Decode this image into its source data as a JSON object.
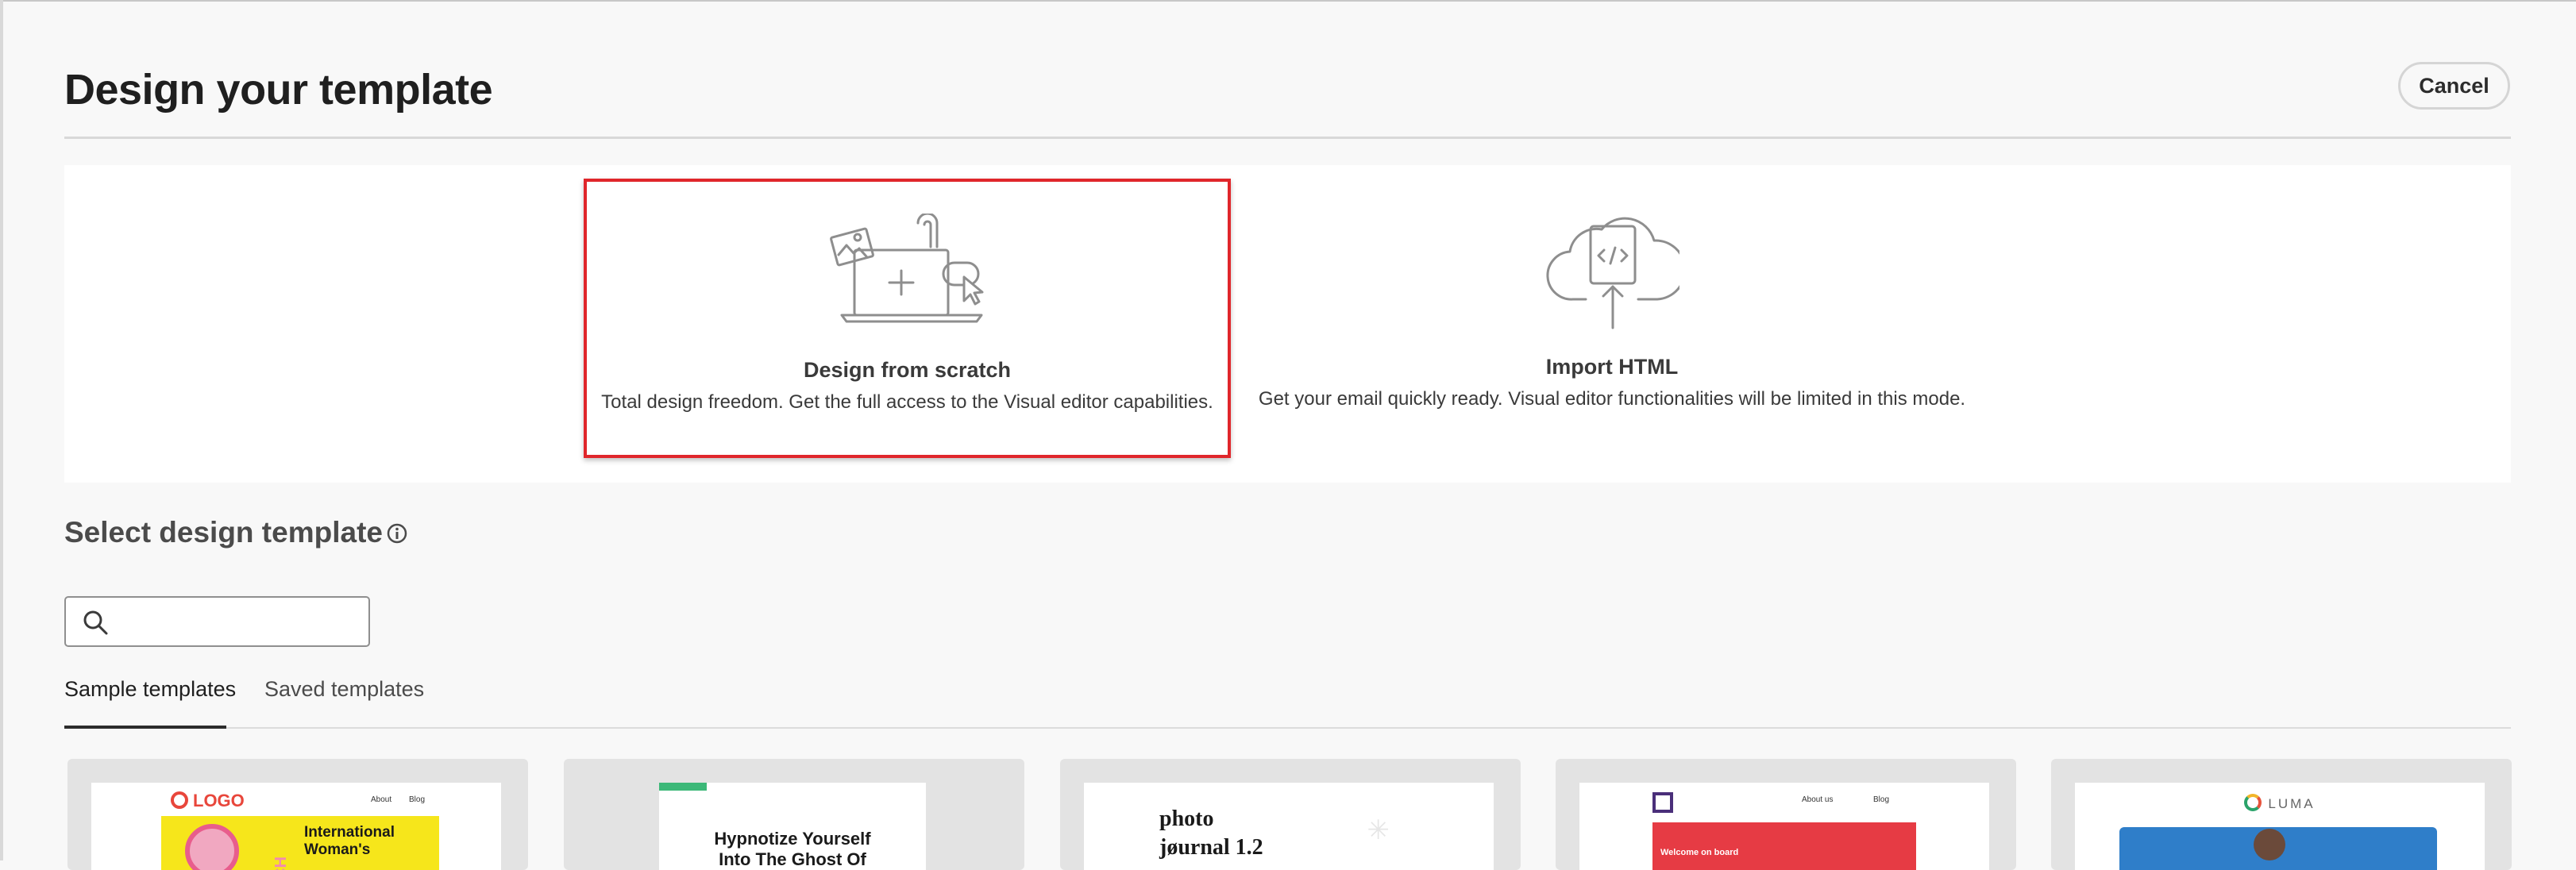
{
  "header": {
    "title": "Design your template",
    "cancel_label": "Cancel"
  },
  "options": [
    {
      "title": "Design from scratch",
      "description": "Total design freedom. Get the full access to the Visual editor capabilities.",
      "icon": "laptop-plus-icon",
      "selected": true
    },
    {
      "title": "Import HTML",
      "description": "Get your email quickly ready. Visual editor functionalities will be limited in this mode.",
      "icon": "cloud-upload-code-icon",
      "selected": false
    }
  ],
  "templates_section": {
    "title": "Select design template",
    "search_value": "",
    "tabs": [
      {
        "label": "Sample templates",
        "active": true
      },
      {
        "label": "Saved templates",
        "active": false
      }
    ]
  },
  "templates": [
    {
      "logo": "LOGO",
      "nav": [
        "About",
        "Blog"
      ],
      "side_text": "CH",
      "headline": [
        "International",
        "Woman's"
      ]
    },
    {
      "headline": [
        "Hypnotize Yourself",
        "Into The Ghost Of"
      ]
    },
    {
      "headline": [
        "photo",
        "jøurnal 1.2"
      ]
    },
    {
      "nav": [
        "About us",
        "Blog"
      ],
      "banner_text": "Welcome on board"
    },
    {
      "logo": "LUMA"
    }
  ],
  "colors": {
    "selection_border": "#e0262b",
    "background": "#f8f8f8",
    "panel": "#ffffff"
  }
}
